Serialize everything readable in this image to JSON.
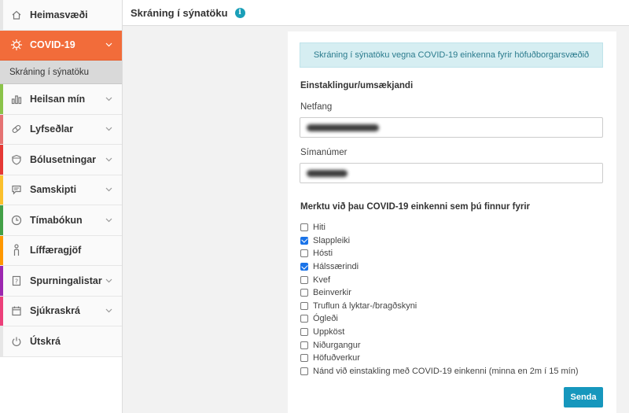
{
  "sidebar": {
    "items": [
      {
        "label": "Heimasvæði",
        "icon": "home-icon",
        "stripe": "#e6e6e6",
        "chevron": false
      },
      {
        "label": "COVID-19",
        "icon": "virus-icon",
        "stripe": "#f26c3a",
        "chevron": true,
        "active": true
      },
      {
        "label": "Heilsan mín",
        "icon": "chart-icon",
        "stripe": "#8bc34a",
        "chevron": true
      },
      {
        "label": "Lyfseðlar",
        "icon": "pill-icon",
        "stripe": "#e57373",
        "chevron": true
      },
      {
        "label": "Bólusetningar",
        "icon": "shield-icon",
        "stripe": "#e53935",
        "chevron": true
      },
      {
        "label": "Samskipti",
        "icon": "chat-icon",
        "stripe": "#fbc02d",
        "chevron": true
      },
      {
        "label": "Tímabókun",
        "icon": "clock-icon",
        "stripe": "#43a047",
        "chevron": true
      },
      {
        "label": "Líffæragjöf",
        "icon": "person-icon",
        "stripe": "#ff9800",
        "chevron": false
      },
      {
        "label": "Spurningalistar",
        "icon": "question-doc-icon",
        "stripe": "#9c27b0",
        "chevron": true
      },
      {
        "label": "Sjúkraskrá",
        "icon": "calendar-icon",
        "stripe": "#ec407a",
        "chevron": true
      },
      {
        "label": "Útskrá",
        "icon": "power-icon",
        "stripe": "#e6e6e6",
        "chevron": false
      }
    ],
    "sub_item": "Skráning í sýnatöku"
  },
  "header": {
    "title": "Skráning í sýnatöku",
    "info_glyph": "i"
  },
  "form": {
    "alert": "Skráning í sýnatöku vegna COVID-19 einkenna fyrir höfuðborgarsvæðið",
    "section_title": "Einstaklingur/umsækjandi",
    "email_label": "Netfang",
    "phone_label": "Símanúmer",
    "symptoms_title": "Merktu við þau COVID-19 einkenni sem þú finnur fyrir",
    "symptoms": [
      {
        "label": "Hiti",
        "checked": false
      },
      {
        "label": "Slappleiki",
        "checked": true
      },
      {
        "label": "Hósti",
        "checked": false
      },
      {
        "label": "Hálssærindi",
        "checked": true
      },
      {
        "label": "Kvef",
        "checked": false
      },
      {
        "label": "Beinverkir",
        "checked": false
      },
      {
        "label": "Truflun á lyktar-/bragðskyni",
        "checked": false
      },
      {
        "label": "Ógleði",
        "checked": false
      },
      {
        "label": "Uppköst",
        "checked": false
      },
      {
        "label": "Niðurgangur",
        "checked": false
      },
      {
        "label": "Höfuðverkur",
        "checked": false
      },
      {
        "label": "Nánd við einstakling með COVID-19 einkenni (minna en 2m í 15 mín)",
        "checked": false
      }
    ],
    "submit_label": "Senda"
  },
  "colors": {
    "accent": "#f26c3a",
    "primary_button": "#1697bd",
    "alert_bg": "#d6eef2",
    "alert_text": "#2a7b8d"
  }
}
